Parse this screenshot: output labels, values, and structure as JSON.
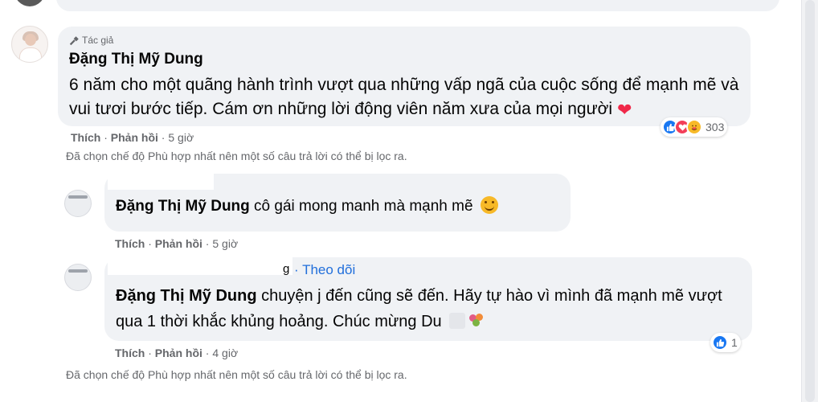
{
  "main_comment": {
    "author_badge": "Tác giả",
    "author": "Đặng Thị Mỹ Dung",
    "text": "6 năm cho một quãng hành trình vượt qua những vấp ngã của cuộc sống để mạnh mẽ và vui tươi bước tiếp. Cám ơn những lời động viên năm xưa của mọi người",
    "like": "Thích",
    "reply": "Phản hồi",
    "time": "5 giờ",
    "reaction_count": "303"
  },
  "filter_note": "Đã chọn chế độ Phù hợp nhất nên một số câu trả lời có thể bị lọc ra.",
  "reply_1": {
    "tag": "Đặng Thị Mỹ Dung",
    "text": "cô gái mong manh mà mạnh mẽ",
    "like": "Thích",
    "reply": "Phản hồi",
    "time": "5 giờ"
  },
  "reply_2": {
    "name_tail": "g",
    "follow": "Theo dõi",
    "tag": "Đặng Thị Mỹ Dung",
    "text": "chuyện j đến cũng sẽ đến. Hãy tự hào vì mình đã mạnh mẽ vượt qua 1 thời khắc khủng hoảng. Chúc mừng Du",
    "like": "Thích",
    "reply": "Phản hồi",
    "time": "4 giờ",
    "reaction_count": "1"
  },
  "colors": {
    "bubble": "#f0f2f5",
    "meta": "#65676b",
    "link": "#216fdb",
    "like": "#1877f2",
    "love": "#f33e58",
    "care": "#f7b928"
  }
}
